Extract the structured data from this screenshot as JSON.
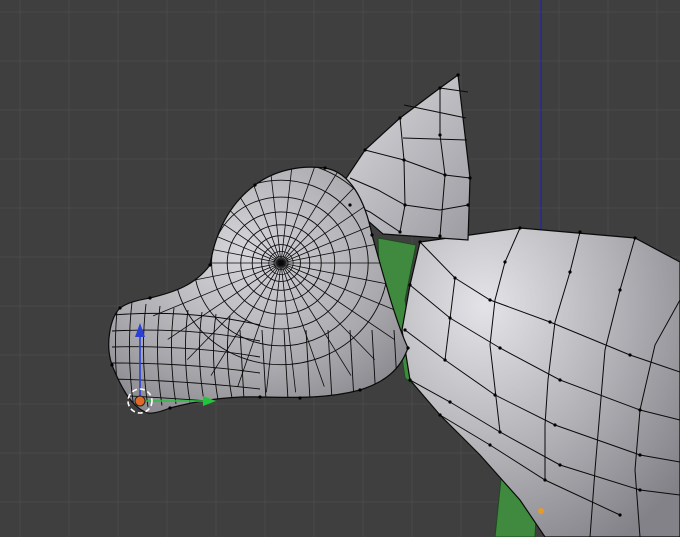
{
  "viewport": {
    "mode": "edit-mode-mesh",
    "background_color": "#3f3f3f",
    "grid_color": "#4a4a4a",
    "z_axis_color": "#2222aa"
  },
  "mesh": {
    "surface_color": "#b9b9be",
    "wire_color": "#0a0a0a",
    "vertex_color": "#000000",
    "interior_color": "#3f8a3f",
    "selected_vertex_color": "#e59a2a"
  },
  "gizmo": {
    "x_axis_color": "#22c43a",
    "z_axis_color": "#2a3fd6",
    "cursor_ring_color": "#ffffff",
    "cursor_fill_color": "#e06a2a"
  }
}
